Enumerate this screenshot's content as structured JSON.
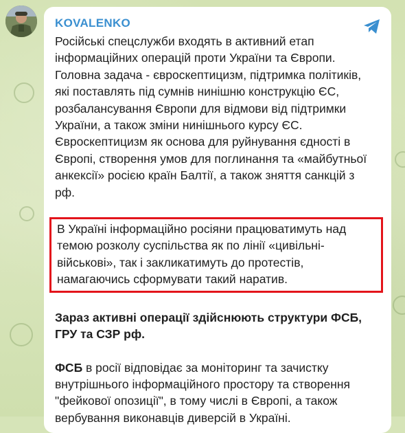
{
  "channel": {
    "name": "KOVALENKO"
  },
  "message": {
    "paragraph1": "Російські спецслужби входять в активний етап інформаційних операцій проти України та Європи. Головна задача - євроскептицизм, підтримка політиків, які поставлять під сумнів нинішню конструкцію ЄС, розбалансування Європи для відмови від підтримки України, а також зміни нинішнього курсу ЄС. Євроскептицизм як основа для руйнування єдності в Європі, створення умов для поглинання та «майбутньої анкексії» росією країн Балтії, а також зняття санкцій з рф.",
    "paragraph2": "В Україні інформаційно росіяни працюватимуть над темою розколу суспільства як по лінії «цивільні-військові», так і закликатимуть до протестів, намагаючись сформувати такий наратив.",
    "paragraph3": "Зараз активні операції здійснюють структури ФСБ, ГРУ та СЗР рф.",
    "paragraph4_bold": "ФСБ",
    "paragraph4_rest": " в росії відповідає за моніторинг та зачистку внутрішнього інформаційного простору та створення \"фейкової опозиції\", в тому числі в Європі, а також вербування виконавців диверсій в Україні."
  },
  "icons": {
    "share": "telegram-share-icon",
    "avatar": "channel-avatar"
  },
  "colors": {
    "channel_name": "#3a8fd0",
    "highlight_border": "#e3141b",
    "share_icon": "#3a8fd0",
    "background": "#d6e4b8"
  }
}
